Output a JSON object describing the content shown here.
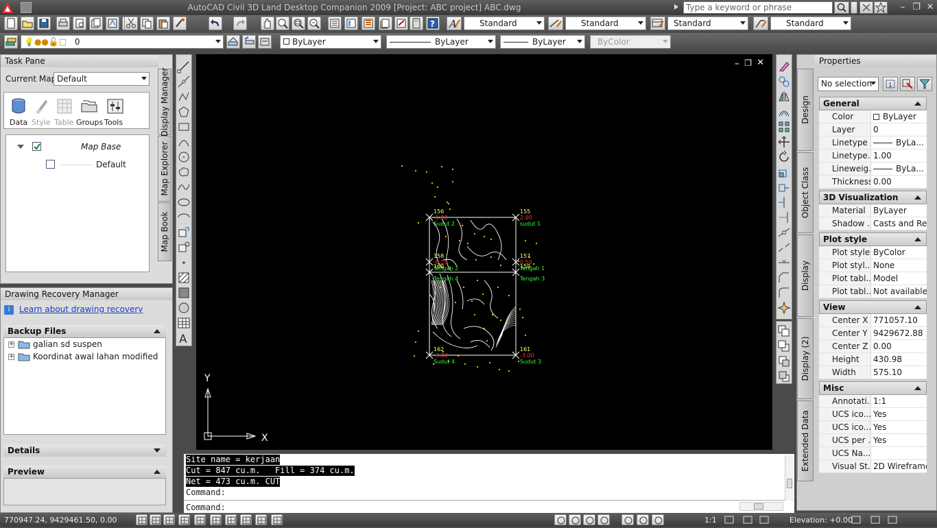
{
  "window": {
    "title": "AutoCAD Civil 3D Land Desktop Companion 2009 [Project: ABC project] ABC.dwg",
    "search_placeholder": "Type a keyword or phrase"
  },
  "styles_toolbar": {
    "text_style": "Standard",
    "dim_style": "Standard",
    "table_style": "Standard",
    "multileader_style": "Standard"
  },
  "layers_toolbar": {
    "layer": "0",
    "color": "ByLayer",
    "linetype": "ByLayer",
    "lineweight": "ByLayer",
    "plotstyle": "ByColor"
  },
  "task_pane": {
    "title": "Task Pane",
    "current_map_label": "Current Map:",
    "current_map_value": "Default",
    "tools": [
      "Data",
      "Style",
      "Table",
      "Groups",
      "Tools"
    ],
    "tree": {
      "root": "Map Base",
      "child": "Default"
    },
    "side_tabs": [
      "Display Manager",
      "Map Explorer",
      "Map Book"
    ]
  },
  "recovery": {
    "title": "Drawing Recovery Manager",
    "link": "Learn about drawing recovery",
    "backup_header": "Backup Files",
    "files": [
      "galian sd suspen",
      "Koordinat awal lahan modified"
    ],
    "details": "Details",
    "preview": "Preview"
  },
  "drawing": {
    "points": [
      {
        "num": "156",
        "elev": "-1.00",
        "desc": "Sudut 2"
      },
      {
        "num": "155",
        "elev": "2.00",
        "desc": "sudut 1"
      },
      {
        "num": "158",
        "elev": "-0.25",
        "desc": "Tengah 2"
      },
      {
        "num": "157",
        "elev": "0.50",
        "desc": "Tengah 1"
      },
      {
        "num": "160",
        "elev": "",
        "desc": "Tengah 4"
      },
      {
        "num": "159",
        "elev": "",
        "desc": "Tengah 3"
      },
      {
        "num": "162",
        "elev": "-3.00",
        "desc": "Sudut 4"
      },
      {
        "num": "161",
        "elev": "-3.00",
        "desc": "Sudut 3"
      }
    ],
    "ucs_x": "X",
    "ucs_y": "Y"
  },
  "command": {
    "lines": [
      "Site name = kerjaan",
      "Cut = 847 cu.m.   Fill = 374 cu.m.",
      "Net = 473 cu.m. CUT"
    ],
    "prompt1": "Command:",
    "prompt2": "Command:"
  },
  "status": {
    "coords": "770947.24, 9429461.50, 0.00",
    "scale": "1:1",
    "elevation": "Elevation: +0.00"
  },
  "properties": {
    "title": "Properties",
    "selection": "No selection",
    "side_tabs": [
      "Design",
      "Object Class",
      "Display",
      "Display (2)",
      "Extended Data"
    ],
    "sections": [
      {
        "name": "General",
        "rows": [
          {
            "k": "Color",
            "v": "ByLayer"
          },
          {
            "k": "Layer",
            "v": "0"
          },
          {
            "k": "Linetype",
            "v": "ByLa..."
          },
          {
            "k": "Linetype...",
            "v": "1.00"
          },
          {
            "k": "Lineweig...",
            "v": "ByLa..."
          },
          {
            "k": "Thickness",
            "v": "0.00"
          }
        ]
      },
      {
        "name": "3D Visualization",
        "rows": [
          {
            "k": "Material",
            "v": "ByLayer"
          },
          {
            "k": "Shadow ...",
            "v": "Casts and Re..."
          }
        ]
      },
      {
        "name": "Plot style",
        "rows": [
          {
            "k": "Plot style",
            "v": "ByColor"
          },
          {
            "k": "Plot styl...",
            "v": "None"
          },
          {
            "k": "Plot tabl...",
            "v": "Model"
          },
          {
            "k": "Plot tabl...",
            "v": "Not available"
          }
        ]
      },
      {
        "name": "View",
        "rows": [
          {
            "k": "Center X",
            "v": "771057.10"
          },
          {
            "k": "Center Y",
            "v": "9429672.88"
          },
          {
            "k": "Center Z",
            "v": "0.00"
          },
          {
            "k": "Height",
            "v": "430.98"
          },
          {
            "k": "Width",
            "v": "575.10"
          }
        ]
      },
      {
        "name": "Misc",
        "rows": [
          {
            "k": "Annotati...",
            "v": "1:1"
          },
          {
            "k": "UCS ico...",
            "v": "Yes"
          },
          {
            "k": "UCS ico...",
            "v": "Yes"
          },
          {
            "k": "UCS per ...",
            "v": "Yes"
          },
          {
            "k": "UCS Na...",
            "v": ""
          },
          {
            "k": "Visual St...",
            "v": "2D Wireframe"
          }
        ]
      }
    ]
  },
  "colors": {
    "point_number": "#ffff66",
    "point_elev": "#ff3333",
    "point_desc": "#33ff33",
    "contour": "#ffffff",
    "scatter": "#ffcc00"
  }
}
